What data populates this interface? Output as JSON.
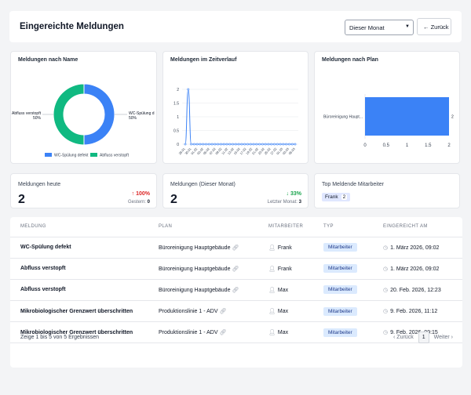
{
  "header": {
    "title": "Eingereichte Meldungen",
    "period_select": "Dieser Monat",
    "back_label": "Zurück"
  },
  "charts": {
    "by_name_title": "Meldungen nach Name",
    "timeline_title": "Meldungen im Zeitverlauf",
    "by_plan_title": "Meldungen nach Plan"
  },
  "chart_data": [
    {
      "type": "pie",
      "title": "Meldungen nach Name",
      "categories": [
        "WC-Spülung defekt",
        "Abfluss verstopft"
      ],
      "values": [
        50,
        50
      ],
      "slice_labels": [
        "WC-Spülung d",
        "Abfluss verstopft"
      ],
      "percent_labels": [
        "50%",
        "50%"
      ],
      "colors": [
        "#3b82f6",
        "#10b981"
      ],
      "legend": [
        "WC-Spülung defekt",
        "Abfluss verstopft"
      ],
      "legend_placement": "bottom"
    },
    {
      "type": "line",
      "title": "Meldungen im Zeitverlauf",
      "ylim": [
        0,
        2
      ],
      "yticks": [
        "0",
        "0.5",
        "1",
        "1.5",
        "2"
      ],
      "x": [
        "28.01",
        "30.01",
        "01.02",
        "03.02",
        "05.02",
        "07.02",
        "09.02",
        "11.02",
        "13.02",
        "15.02",
        "17.02",
        "19.02",
        "21.02",
        "23.02",
        "25.02",
        "27.02",
        "01.03",
        "03.03",
        "05.03"
      ],
      "values": [
        0,
        2,
        0,
        0,
        0,
        0,
        0,
        0,
        0,
        0,
        0,
        0,
        0,
        0,
        0,
        0,
        0,
        0,
        0,
        0,
        0,
        0,
        0,
        0,
        0,
        0,
        0,
        0,
        0,
        0,
        0,
        0,
        0,
        0,
        0,
        0,
        0,
        0
      ],
      "color": "#3b82f6",
      "grid": true
    },
    {
      "type": "bar",
      "orientation": "horizontal",
      "title": "Meldungen nach Plan",
      "categories": [
        "Büroreinigung Haupt..."
      ],
      "values": [
        2
      ],
      "xlim": [
        0,
        2
      ],
      "xticks": [
        "0",
        "0.5",
        "1",
        "1.5",
        "2"
      ],
      "color": "#3b82f6"
    }
  ],
  "stats": {
    "today": {
      "title": "Meldungen heute",
      "value": "2",
      "delta": "↑ 100%",
      "sub_label": "Gestern:",
      "sub_value": "0",
      "color": "#dc2626"
    },
    "month": {
      "title": "Meldungen (Dieser Monat)",
      "value": "2",
      "delta": "↓ 33%",
      "sub_label": "Letzter Monat:",
      "sub_value": "3",
      "color": "#16a34a"
    },
    "top": {
      "title": "Top Meldende Mitarbeiter",
      "name": "Frank",
      "count": "2"
    }
  },
  "table": {
    "columns": [
      "MELDUNG",
      "PLAN",
      "MITARBEITER",
      "TYP",
      "EINGEREICHT AM"
    ],
    "rows": [
      {
        "meldung": "WC-Spülung defekt",
        "plan": "Büroreinigung Hauptgebäude",
        "mitarbeiter": "Frank",
        "typ": "Mitarbeiter",
        "datum": "1. März 2026, 09:02"
      },
      {
        "meldung": "Abfluss verstopft",
        "plan": "Büroreinigung Hauptgebäude",
        "mitarbeiter": "Frank",
        "typ": "Mitarbeiter",
        "datum": "1. März 2026, 09:02"
      },
      {
        "meldung": "Abfluss verstopft",
        "plan": "Büroreinigung Hauptgebäude",
        "mitarbeiter": "Max",
        "typ": "Mitarbeiter",
        "datum": "20. Feb. 2026, 12:23"
      },
      {
        "meldung": "Mikrobiologischer Grenzwert überschritten",
        "plan": "Produktionslinie 1 - ADV",
        "mitarbeiter": "Max",
        "typ": "Mitarbeiter",
        "datum": "9. Feb. 2026, 11:12"
      },
      {
        "meldung": "Mikrobiologischer Grenzwert überschritten",
        "plan": "Produktionslinie 1 - ADV",
        "mitarbeiter": "Max",
        "typ": "Mitarbeiter",
        "datum": "9. Feb. 2026, 09:15"
      }
    ],
    "summary": "Zeige 1 bis 5 von 5 Ergebnissen",
    "pager": {
      "prev": "Zurück",
      "current": "1",
      "next": "Weiter"
    }
  }
}
